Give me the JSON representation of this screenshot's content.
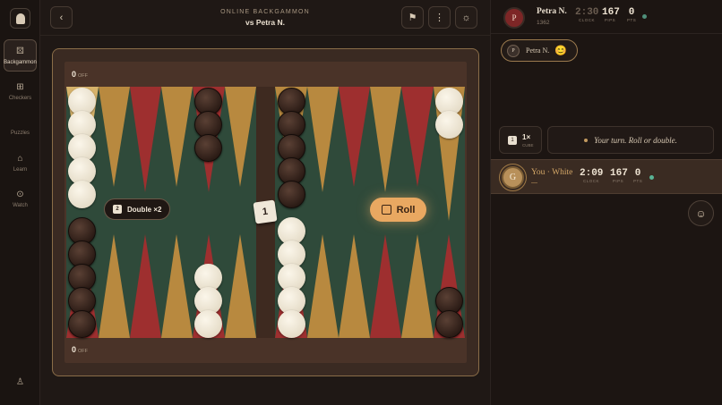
{
  "nav": {
    "items": [
      {
        "label": "Backgammon",
        "icon": "die-icon"
      },
      {
        "label": "Checkers",
        "icon": "grid-icon"
      },
      {
        "label": "Puzzles",
        "icon": "puzzle-icon"
      },
      {
        "label": "Learn",
        "icon": "graduation-cap-icon"
      },
      {
        "label": "Watch",
        "icon": "play-icon"
      }
    ]
  },
  "header": {
    "subtitle": "ONLINE BACKGAMMON",
    "title": "vs Petra N."
  },
  "board": {
    "top_off": "0",
    "bottom_off": "0",
    "off_label": "OFF",
    "double_label": "Double ×2",
    "double_cube": "2",
    "cube_value": "1",
    "roll_label": "Roll",
    "colors": {
      "felt": "#2f4a3a",
      "red": "#9e2f2f",
      "gold": "#b8893f",
      "cream": "#d6b26a"
    }
  },
  "opponent": {
    "initial": "P",
    "name": "Petra N.",
    "rating": "1362",
    "clock": "2:30",
    "clock_label": "CLOCK",
    "pips": "167",
    "pips_label": "PIPS",
    "pts": "0",
    "pts_label": "PTS"
  },
  "chat_chip": {
    "initial": "P",
    "name": "Petra N.",
    "emoji": "😊"
  },
  "cube_box": {
    "die": "1",
    "value": "1×",
    "label": "CUBE"
  },
  "turn_message": "Your turn. Roll or double.",
  "you": {
    "initial": "G",
    "name": "You · White",
    "sub": "—",
    "clock": "2:09",
    "clock_label": "CLOCK",
    "pips": "167",
    "pips_label": "PIPS",
    "pts": "0",
    "pts_label": "PTS"
  }
}
